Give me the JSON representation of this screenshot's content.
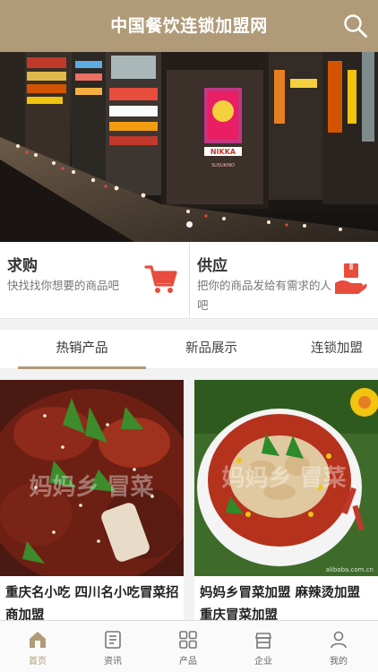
{
  "header": {
    "title": "中国餐饮连锁加盟网",
    "search_icon": "search-icon"
  },
  "banner": {
    "sign_text": "NIKKA",
    "sign_subtext": "SUSUKINO",
    "active_slide": 1,
    "slide_count": 1
  },
  "supply": {
    "buy": {
      "title": "求购",
      "desc": "快找找你想要的商品吧",
      "icon": "cart-icon"
    },
    "sell": {
      "title": "供应",
      "desc": "把你的商品发给有需求的人吧",
      "icon": "hand-box-icon"
    }
  },
  "tabs": [
    {
      "label": "热销产品",
      "active": true
    },
    {
      "label": "新品展示",
      "active": false
    },
    {
      "label": "连锁加盟",
      "active": false
    }
  ],
  "products": [
    {
      "name": "重庆名小吃 四川名小吃冒菜招商加盟",
      "watermark": "妈妈乡 冒菜"
    },
    {
      "name": "妈妈乡冒菜加盟 麻辣烫加盟 重庆冒菜加盟",
      "watermark": "妈妈乡 冒菜",
      "credit": "alibaba.com.cn"
    }
  ],
  "tabbar": [
    {
      "label": "首页",
      "icon": "home-icon",
      "active": true
    },
    {
      "label": "资讯",
      "icon": "news-icon",
      "active": false
    },
    {
      "label": "产品",
      "icon": "grid-icon",
      "active": false
    },
    {
      "label": "企业",
      "icon": "building-icon",
      "active": false
    },
    {
      "label": "我的",
      "icon": "user-icon",
      "active": false
    }
  ],
  "colors": {
    "accent": "#b09a78",
    "cart_red": "#e74c3c"
  }
}
